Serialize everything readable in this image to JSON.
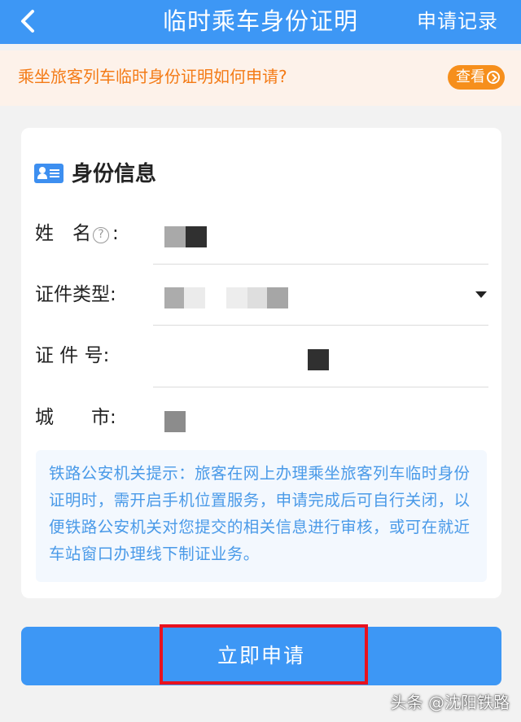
{
  "header": {
    "title": "临时乘车身份证明",
    "records_link": "申请记录",
    "back_icon": "chevron-left-icon"
  },
  "notice": {
    "text": "乘坐旅客列车临时身份证明如何申请?",
    "view_button": "查看"
  },
  "identity": {
    "section_title": "身份信息",
    "section_icon": "id-card-icon",
    "fields": [
      {
        "label": "姓　名",
        "help_icon": "question-circle-icon",
        "suffix": ":"
      },
      {
        "label": "证件类型:",
        "control": "select"
      },
      {
        "label": "证 件 号:"
      },
      {
        "label": "城　　市:"
      }
    ],
    "tip": "铁路公安机关提示：旅客在网上办理乘坐旅客列车临时身份证明时，需开启手机位置服务，申请完成后可自行关闭，以便铁路公安机关对您提交的相关信息进行审核，或可在就近车站窗口办理线下制证业务。"
  },
  "actions": {
    "submit_label": "立即申请"
  },
  "watermark": "头条 @沈阳铁路",
  "colors": {
    "primary": "#3d97f5",
    "notice_text": "#f47b16",
    "notice_bg": "#fdf2ea",
    "view_button": "#f68f1c",
    "tip_text": "#4a9ae8",
    "highlight": "#e8121f"
  }
}
